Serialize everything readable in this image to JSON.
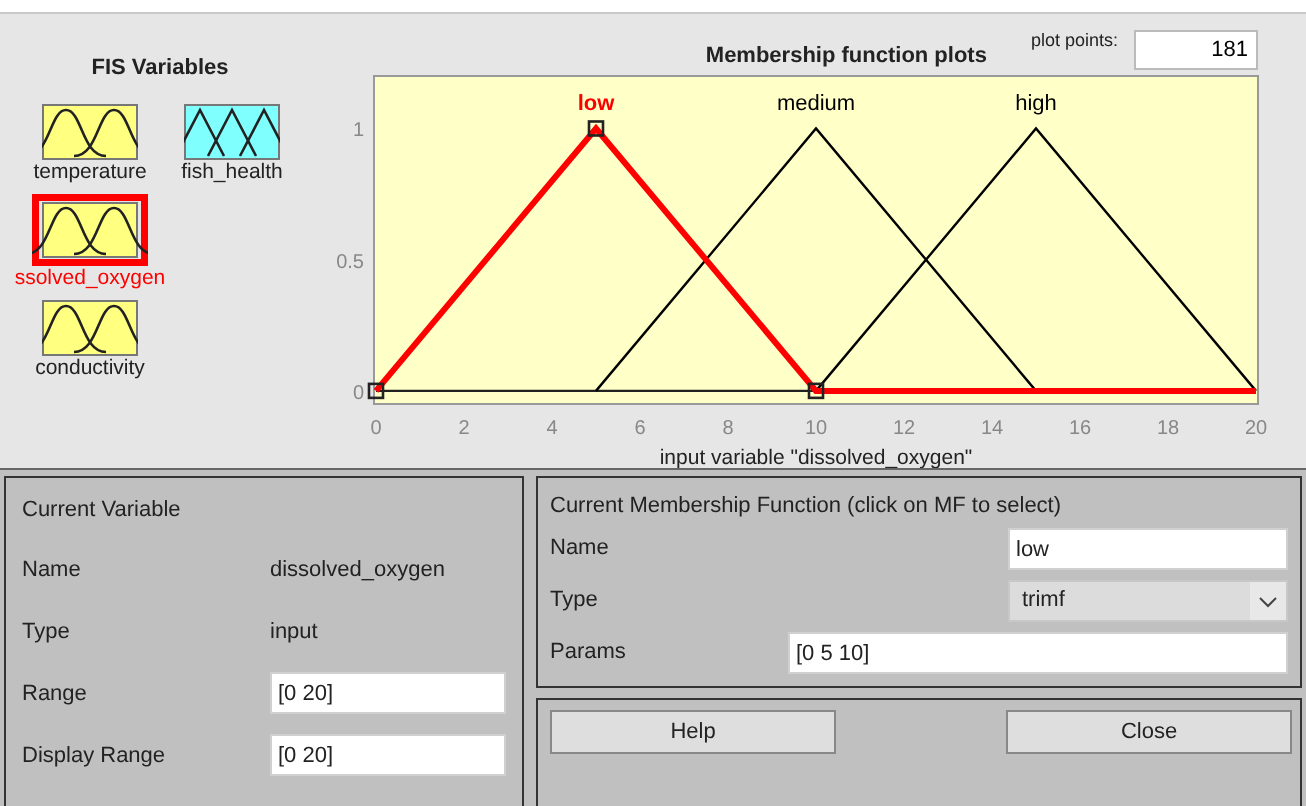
{
  "fis_variables": {
    "title": "FIS Variables",
    "inputs": [
      {
        "name": "temperature",
        "color": "#ffff80",
        "selected": false
      },
      {
        "name": "ssolved_oxygen",
        "color": "#ffff80",
        "selected": true
      },
      {
        "name": "conductivity",
        "color": "#ffff80",
        "selected": false
      }
    ],
    "outputs": [
      {
        "name": "fish_health",
        "color": "#80ffff",
        "selected": false
      }
    ]
  },
  "plot": {
    "mf_states": [
      {
        "selected": true
      },
      {
        "selected": false
      },
      {
        "selected": false
      }
    ],
    "plot_points_label": "plot points:",
    "plot_points": "181",
    "chart_data": {
      "type": "line",
      "title": "Membership function plots",
      "xlabel": "input variable \"dissolved_oxygen\"",
      "x": [
        0,
        5,
        10,
        15,
        20
      ],
      "series": [
        {
          "name": "low",
          "color": "#ff0000",
          "values": [
            0,
            1,
            0,
            0,
            0
          ]
        },
        {
          "name": "medium",
          "color": "#000000",
          "values": [
            null,
            0,
            1,
            0,
            null
          ]
        },
        {
          "name": "high",
          "color": "#000000",
          "values": [
            null,
            null,
            0,
            1,
            0
          ]
        }
      ],
      "xlim": [
        0,
        20
      ],
      "ylim": [
        -0.05,
        1.2
      ],
      "xticks": [
        0,
        2,
        4,
        6,
        8,
        10,
        12,
        14,
        16,
        18,
        20
      ],
      "yticks": [
        0,
        0.5,
        1
      ]
    }
  },
  "current_variable": {
    "title": "Current Variable",
    "rows": [
      {
        "label": "Name",
        "kind": "text",
        "value": "dissolved_oxygen"
      },
      {
        "label": "Type",
        "kind": "text",
        "value": "input"
      },
      {
        "label": "Range",
        "kind": "field",
        "value": "[0 20]"
      },
      {
        "label": "Display Range",
        "kind": "field",
        "value": "[0 20]"
      }
    ]
  },
  "current_mf": {
    "title": "Current Membership Function (click on MF to select)",
    "name_label": "Name",
    "name": "low",
    "type_label": "Type",
    "type": "trimf",
    "params_label": "Params",
    "params": "[0 5 10]"
  },
  "buttons": [
    "Help",
    "Close"
  ]
}
